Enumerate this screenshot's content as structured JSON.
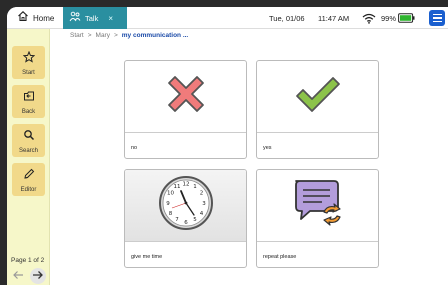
{
  "topbar": {
    "home_label": "Home",
    "talk_label": "Talk",
    "talk_close": "×",
    "date": "Tue, 01/06",
    "time": "11:47 AM",
    "battery": "99%"
  },
  "sidebar": {
    "items": [
      {
        "label": "Start",
        "icon": "star-icon"
      },
      {
        "label": "Back",
        "icon": "back-icon"
      },
      {
        "label": "Search",
        "icon": "search-icon"
      },
      {
        "label": "Editor",
        "icon": "pencil-icon"
      }
    ],
    "page_label": "Page 1 of 2"
  },
  "breadcrumb": {
    "items": [
      "Start",
      "Mary"
    ],
    "separator": ">",
    "current": "my communication ..."
  },
  "cards": [
    {
      "caption": "no",
      "icon": "cross-icon"
    },
    {
      "caption": "yes",
      "icon": "checkmark-icon"
    },
    {
      "caption": "give me time",
      "icon": "clock-photo"
    },
    {
      "caption": "repeat please",
      "icon": "repeat-message-icon"
    }
  ],
  "colors": {
    "talk_tab": "#2a8fa0",
    "sidebar_bg": "#f6f7c9",
    "sidebar_button": "#f1d98a",
    "menu_button": "#1a5fcf",
    "battery_green": "#2fb52f",
    "cross_red": "#f07b7b",
    "check_green": "#8cc34a",
    "breadcrumb_current": "#1a4aa8"
  }
}
